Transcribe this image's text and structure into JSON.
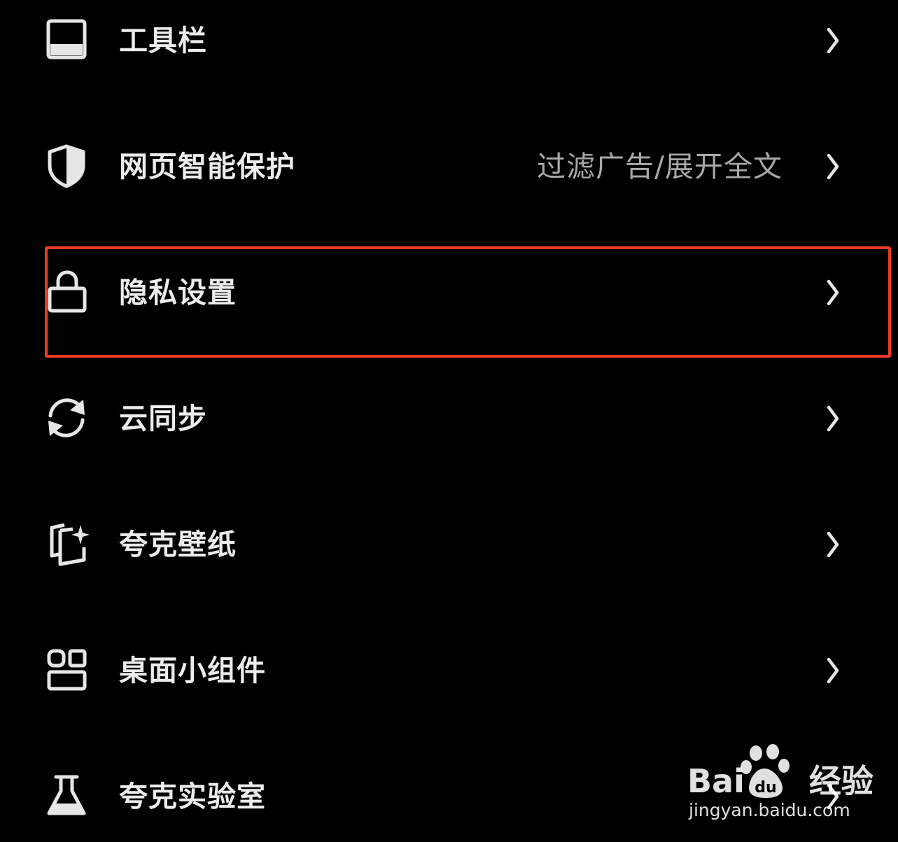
{
  "menu": {
    "items": [
      {
        "label": "工具栏",
        "value": "",
        "icon": "toolbar-icon"
      },
      {
        "label": "网页智能保护",
        "value": "过滤广告/展开全文",
        "icon": "shield-icon"
      },
      {
        "label": "隐私设置",
        "value": "",
        "icon": "lock-icon",
        "highlighted": true
      },
      {
        "label": "云同步",
        "value": "",
        "icon": "sync-icon"
      },
      {
        "label": "夸克壁纸",
        "value": "",
        "icon": "wallpaper-icon"
      },
      {
        "label": "桌面小组件",
        "value": "",
        "icon": "widget-icon"
      },
      {
        "label": "夸克实验室",
        "value": "",
        "icon": "flask-icon"
      }
    ]
  },
  "colors": {
    "background": "#000000",
    "text": "#ececec",
    "secondary_text": "#a9a9a9",
    "highlight_border": "#ee3b24"
  },
  "watermark": {
    "brand": "Bai",
    "brand_du": "du",
    "brand_suffix": "经验",
    "url": "jingyan.baidu.com"
  }
}
